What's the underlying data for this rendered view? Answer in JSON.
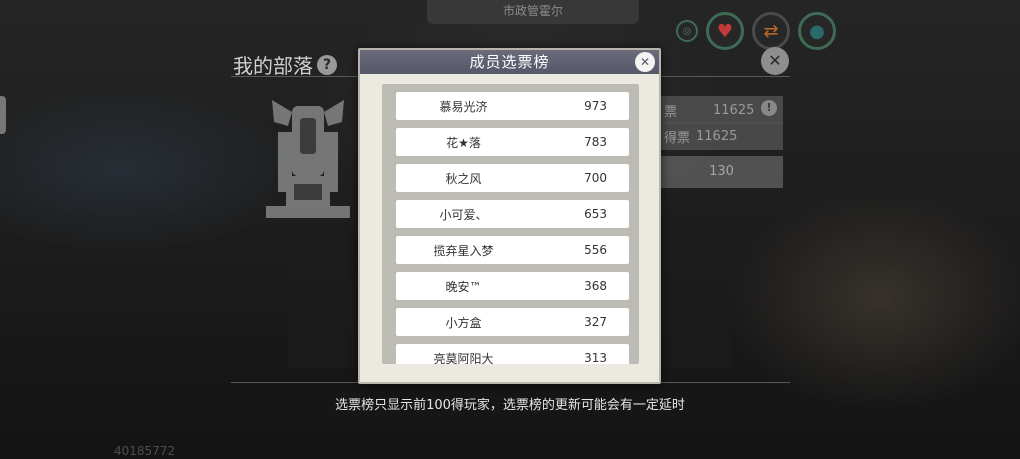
{
  "top_banner": "市政管霍尔",
  "tribe": {
    "title": "我的部落",
    "help_icon": "question-icon",
    "stats": [
      {
        "label": "票",
        "value": "11625"
      },
      {
        "label": "得票",
        "value": "11625"
      }
    ],
    "count": "130",
    "player_id": "40185772"
  },
  "modal": {
    "title": "成员选票榜",
    "close_icon": "close-icon",
    "rows": [
      {
        "name": "慕易光济",
        "votes": "973"
      },
      {
        "name": "花★落",
        "votes": "783"
      },
      {
        "name": "秋之风",
        "votes": "700"
      },
      {
        "name": "小可爱、",
        "votes": "653"
      },
      {
        "name": "揽弃星入梦",
        "votes": "556"
      },
      {
        "name": "晚安™",
        "votes": "368"
      },
      {
        "name": "小方盒",
        "votes": "327"
      },
      {
        "name": "亮莫阿阳大",
        "votes": "313"
      }
    ]
  },
  "footer_note": "选票榜只显示前100得玩家，选票榜的更新可能会有一定延时",
  "colors": {
    "modal_header": "#5e6072",
    "modal_body": "#ece9e0",
    "list_bg": "#bdbcb4"
  }
}
